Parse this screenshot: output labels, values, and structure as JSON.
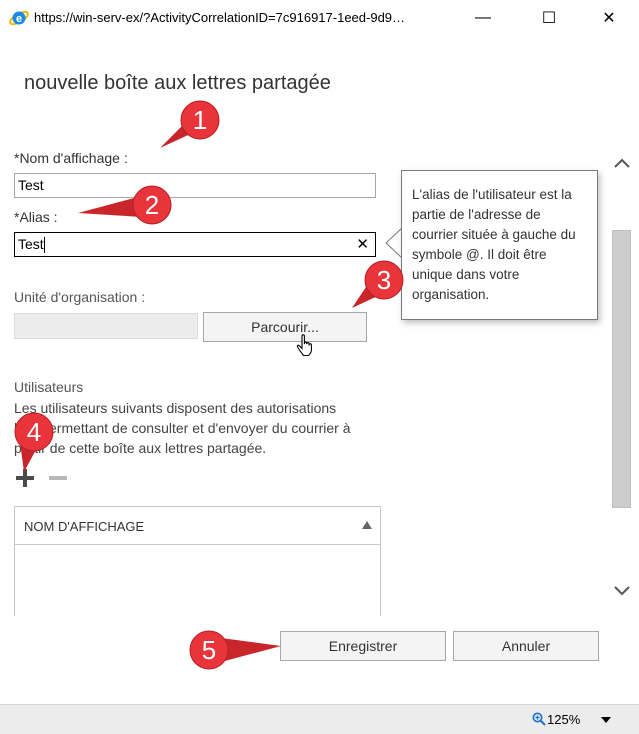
{
  "window": {
    "title": "https://win-serv-ex/?ActivityCorrelationID=7c916917-1eed-9d9…",
    "minimize_glyph": "—",
    "maximize_glyph": "☐",
    "close_glyph": "✕"
  },
  "page": {
    "title": "nouvelle boîte aux lettres partagée"
  },
  "form": {
    "display_name_label": "*Nom d'affichage :",
    "display_name_value": "Test",
    "alias_label": "*Alias :",
    "alias_value": "Test",
    "alias_clear_glyph": "✕",
    "org_unit_label": "Unité d'organisation :",
    "browse_label": "Parcourir...",
    "users_label": "Utilisateurs",
    "users_description": "Les utilisateurs suivants disposent des autorisations leur permettant de consulter et d'envoyer du courrier à partir de cette boîte aux lettres partagée.",
    "table_header": "NOM D'AFFICHAGE"
  },
  "tooltip": {
    "text": "L'alias de l'utilisateur est la partie de l'adresse de courrier située à gauche du symbole @. Il doit être unique dans votre organisation."
  },
  "actions": {
    "save_label": "Enregistrer",
    "cancel_label": "Annuler"
  },
  "status": {
    "zoom": "125%"
  },
  "markers": [
    {
      "label": "1"
    },
    {
      "label": "2"
    },
    {
      "label": "3"
    },
    {
      "label": "4"
    },
    {
      "label": "5"
    }
  ],
  "icons": {
    "browser": "ie-icon",
    "add": "plus-icon",
    "remove": "minus-icon",
    "sort": "sort-ascending-icon",
    "zoom": "magnifier-icon"
  },
  "colors": {
    "marker_red": "#e8343a",
    "ie_blue": "#1e88e5",
    "ie_yellow": "#f5b800"
  }
}
